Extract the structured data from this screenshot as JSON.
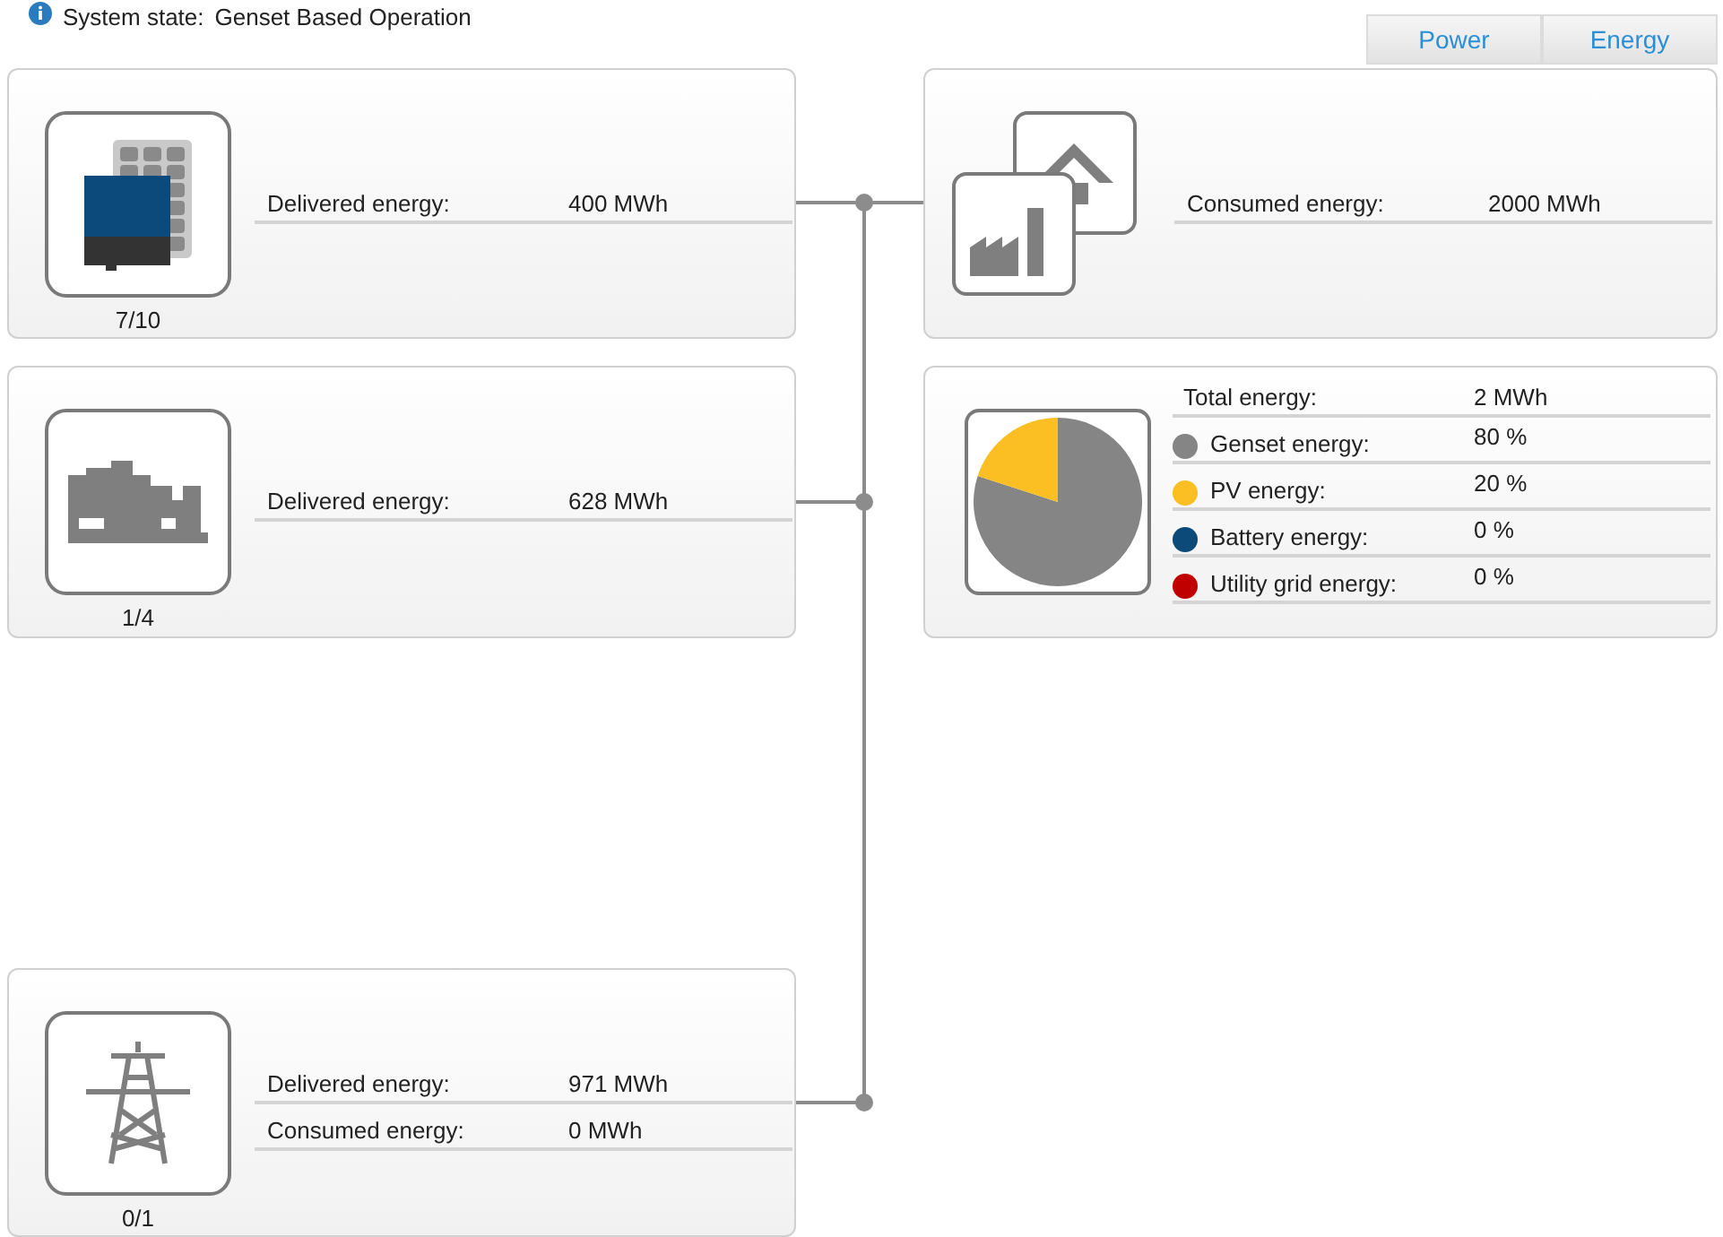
{
  "status": {
    "label": "System state:",
    "value": "Genset Based Operation"
  },
  "tabs": [
    {
      "label": "Power"
    },
    {
      "label": "Energy"
    }
  ],
  "sources": [
    {
      "kind": "pv",
      "count": "7/10",
      "rows": [
        {
          "label": "Delivered energy:",
          "value": "400 MWh"
        }
      ]
    },
    {
      "kind": "genset",
      "count": "1/4",
      "rows": [
        {
          "label": "Delivered energy:",
          "value": "628 MWh"
        }
      ]
    },
    {
      "kind": "grid",
      "count": "0/1",
      "rows": [
        {
          "label": "Delivered energy:",
          "value": "971 MWh"
        },
        {
          "label": "Consumed energy:",
          "value": "0 MWh"
        }
      ]
    }
  ],
  "consumers": {
    "rows": [
      {
        "label": "Consumed energy:",
        "value": "2000 MWh"
      }
    ]
  },
  "energy_mix": {
    "total": {
      "label": "Total energy:",
      "value": "2 MWh"
    },
    "items": [
      {
        "label": "Genset energy:",
        "value": "80 %",
        "color": "#858585"
      },
      {
        "label": "PV energy:",
        "value": "20 %",
        "color": "#fbbf24"
      },
      {
        "label": "Battery energy:",
        "value": "0 %",
        "color": "#0b4a79"
      },
      {
        "label": "Utility grid energy:",
        "value": "0 %",
        "color": "#c00000"
      }
    ],
    "chart_data": {
      "type": "pie",
      "values": [
        80,
        20,
        0,
        0
      ]
    }
  }
}
